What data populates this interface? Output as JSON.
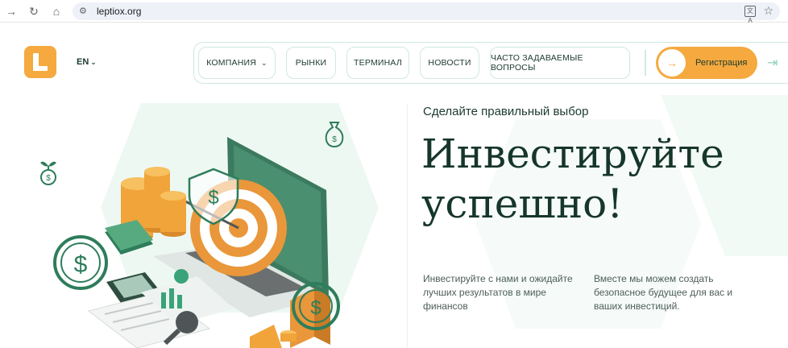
{
  "browser": {
    "url": "leptiox.org",
    "icons": {
      "back": "arrow-right-icon",
      "reload": "reload-icon",
      "home": "home-icon",
      "site_info": "tune-icon",
      "translate": "translate-icon",
      "bookmark": "star-icon"
    }
  },
  "header": {
    "lang": "EN",
    "nav": [
      {
        "label": "КОМПАНИЯ",
        "has_dropdown": true
      },
      {
        "label": "РЫНКИ"
      },
      {
        "label": "ТЕРМИНАЛ"
      },
      {
        "label": "НОВОСТИ"
      },
      {
        "label": "ЧАСТО ЗАДАВАЕМЫЕ ВОПРОСЫ"
      }
    ],
    "register_label": "Регистрация"
  },
  "hero": {
    "eyebrow": "Сделайте правильный выбор",
    "headline_line1": "Инвестируйте",
    "headline_line2": "успешно!",
    "copy_left": "Инвестируйте с нами и ожидайте лучших результатов в мире финансов",
    "copy_right": "Вместе мы можем создать безопасное будущее для вас и ваших инвестиций."
  },
  "colors": {
    "accent": "#f5a93f",
    "dark_green": "#16362a",
    "mint": "#cfe9de",
    "green": "#2e7d5b"
  }
}
